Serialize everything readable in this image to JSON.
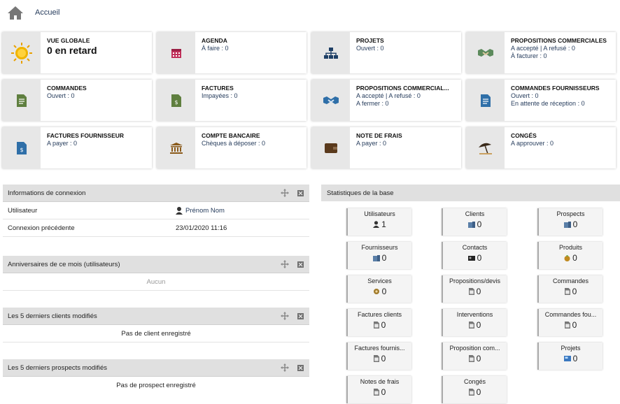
{
  "breadcrumb": {
    "home_label": "Accueil"
  },
  "tiles": [
    {
      "title": "VUE GLOBALE",
      "big": "0 en retard",
      "lines": [],
      "icon": "sun-icon"
    },
    {
      "title": "AGENDA",
      "lines": [
        "À faire : 0"
      ],
      "icon": "calendar-icon"
    },
    {
      "title": "PROJETS",
      "lines": [
        "Ouvert : 0"
      ],
      "icon": "hierarchy-icon"
    },
    {
      "title": "PROPOSITIONS COMMERCIALES",
      "lines": [
        "A accepté | A refusé : 0",
        "À facturer : 0"
      ],
      "icon": "handshake-icon"
    },
    {
      "title": "COMMANDES",
      "lines": [
        "Ouvert : 0"
      ],
      "icon": "document-icon"
    },
    {
      "title": "FACTURES",
      "lines": [
        "Impayées : 0"
      ],
      "icon": "invoice-icon"
    },
    {
      "title": "PROPOSITIONS COMMERCIAL...",
      "lines": [
        "A accepté | A refusé : 0",
        "A fermer : 0"
      ],
      "icon": "handshake-icon"
    },
    {
      "title": "COMMANDES FOURNISSEURS",
      "lines": [
        "Ouvert : 0",
        "En attente de réception : 0"
      ],
      "icon": "document-icon"
    },
    {
      "title": "FACTURES FOURNISSEUR",
      "lines": [
        "A payer : 0"
      ],
      "icon": "invoice-icon"
    },
    {
      "title": "COMPTE BANCAIRE",
      "lines": [
        "Chèques à déposer : 0"
      ],
      "icon": "bank-icon"
    },
    {
      "title": "NOTE DE FRAIS",
      "lines": [
        "A payer : 0"
      ],
      "icon": "wallet-icon"
    },
    {
      "title": "CONGÉS",
      "lines": [
        "A approuver : 0"
      ],
      "icon": "beach-umbrella-icon"
    }
  ],
  "login_panel": {
    "title": "Informations de connexion",
    "rows": [
      {
        "label": "Utilisateur",
        "value": "Prénom Nom"
      },
      {
        "label": "Connexion précédente",
        "value": "23/01/2020 11:16"
      }
    ]
  },
  "birthdays_panel": {
    "title": "Anniversaires de ce mois (utilisateurs)",
    "empty": "Aucun"
  },
  "clients_panel": {
    "title": "Les 5 derniers clients modifiés",
    "empty": "Pas de client enregistré"
  },
  "prospects_panel": {
    "title": "Les 5 derniers prospects modifiés",
    "empty": "Pas de prospect enregistré"
  },
  "stats_panel": {
    "title": "Statistiques de la base",
    "items": [
      {
        "label": "Utilisateurs",
        "value": "1",
        "icon": "user-icon"
      },
      {
        "label": "Clients",
        "value": "0",
        "icon": "building-icon"
      },
      {
        "label": "Prospects",
        "value": "0",
        "icon": "building-icon"
      },
      {
        "label": "Fournisseurs",
        "value": "0",
        "icon": "building-icon"
      },
      {
        "label": "Contacts",
        "value": "0",
        "icon": "contact-icon"
      },
      {
        "label": "Produits",
        "value": "0",
        "icon": "product-icon"
      },
      {
        "label": "Services",
        "value": "0",
        "icon": "service-icon"
      },
      {
        "label": "Propositions/devis",
        "value": "0",
        "icon": "doc-icon"
      },
      {
        "label": "Commandes",
        "value": "0",
        "icon": "doc-icon"
      },
      {
        "label": "Factures clients",
        "value": "0",
        "icon": "doc-icon"
      },
      {
        "label": "Interventions",
        "value": "0",
        "icon": "doc-icon"
      },
      {
        "label": "Commandes fou...",
        "value": "0",
        "icon": "doc-icon"
      },
      {
        "label": "Factures fournis...",
        "value": "0",
        "icon": "doc-icon"
      },
      {
        "label": "Proposition com...",
        "value": "0",
        "icon": "doc-icon"
      },
      {
        "label": "Projets",
        "value": "0",
        "icon": "project-icon"
      },
      {
        "label": "Notes de frais",
        "value": "0",
        "icon": "doc-icon"
      },
      {
        "label": "Congés",
        "value": "0",
        "icon": "doc-icon"
      }
    ]
  }
}
